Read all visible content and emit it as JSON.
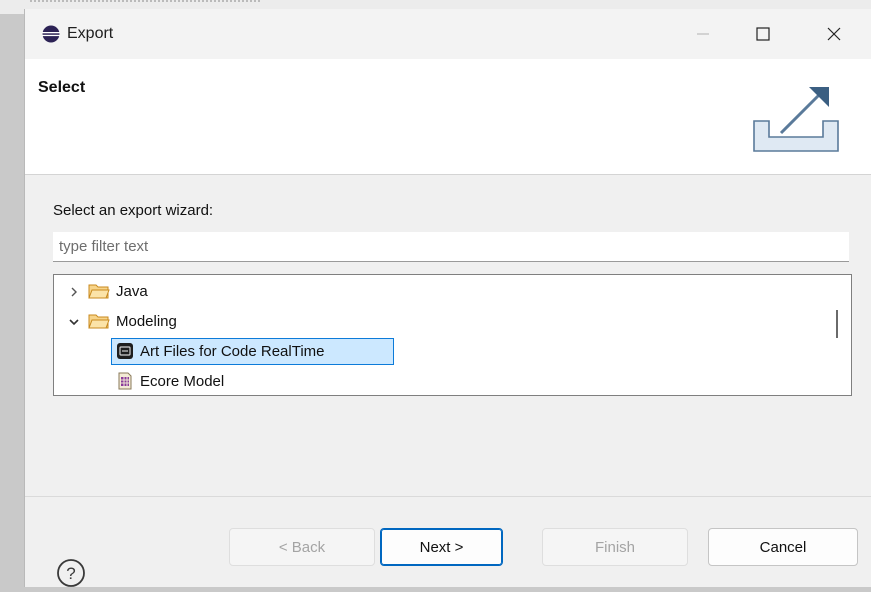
{
  "window": {
    "title": "Export",
    "app_icon": "eclipse-icon",
    "minimize_icon": "minimize-icon",
    "maximize_icon": "maximize-icon",
    "close_icon": "close-icon"
  },
  "banner": {
    "title": "Select",
    "icon": "export-tray-icon"
  },
  "wizard": {
    "prompt": "Select an export wizard:",
    "filter_placeholder": "type filter text",
    "filter_value": "",
    "tree": [
      {
        "label": "Java",
        "expanded": false,
        "icon": "folder-icon"
      },
      {
        "label": "Modeling",
        "expanded": true,
        "icon": "folder-icon",
        "children": [
          {
            "label": "Art Files for Code RealTime",
            "selected": true,
            "icon": "art-file-icon"
          },
          {
            "label": "Ecore Model",
            "selected": false,
            "icon": "ecore-model-icon"
          }
        ]
      }
    ]
  },
  "footer": {
    "help_icon": "help-icon",
    "back_label": "< Back",
    "next_label": "Next >",
    "finish_label": "Finish",
    "cancel_label": "Cancel"
  },
  "colors": {
    "selection_fill": "#cce8ff",
    "selection_border": "#0c7bd9",
    "default_button_border": "#0067c0",
    "folder": "#e8a93a"
  }
}
